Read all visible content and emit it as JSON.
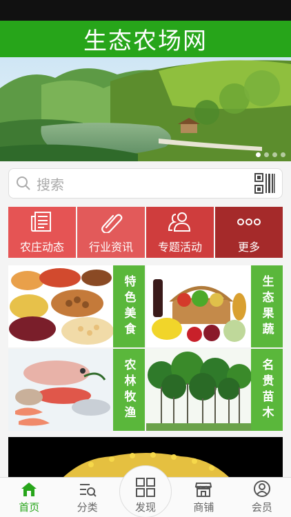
{
  "header": {
    "title": "生态农场网"
  },
  "banner": {
    "slides": 4,
    "active_index": 0
  },
  "search": {
    "placeholder": "搜索",
    "icon": "search-icon",
    "scan_icon": "qr-code-icon"
  },
  "nav": [
    {
      "label": "农庄动态",
      "icon": "newspaper-icon",
      "color": "#e55454"
    },
    {
      "label": "行业资讯",
      "icon": "paperclip-icon",
      "color": "#e25a5a"
    },
    {
      "label": "专题活动",
      "icon": "users-icon",
      "color": "#cf3d3d"
    },
    {
      "label": "更多",
      "icon": "more-dots-icon",
      "color": "#a52a2a"
    }
  ],
  "categories": [
    {
      "label": "特色美食"
    },
    {
      "label": "生态果蔬"
    },
    {
      "label": "农林牧渔"
    },
    {
      "label": "名贵苗木"
    }
  ],
  "tabs": [
    {
      "label": "首页",
      "icon": "home-icon",
      "active": true
    },
    {
      "label": "分类",
      "icon": "category-list-icon",
      "active": false
    },
    {
      "label": "发现",
      "icon": "grid-icon",
      "active": false
    },
    {
      "label": "商铺",
      "icon": "shop-icon",
      "active": false
    },
    {
      "label": "会员",
      "icon": "user-icon",
      "active": false
    }
  ],
  "colors": {
    "brand_green": "#27a51a",
    "tile_green": "#5ab73b"
  }
}
